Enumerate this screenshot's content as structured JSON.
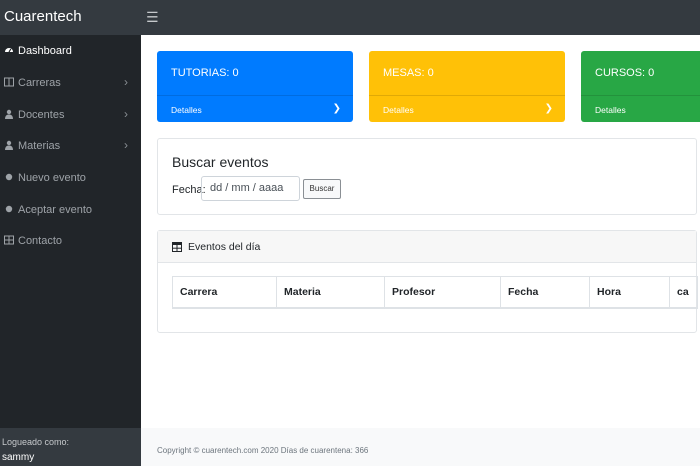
{
  "app": {
    "brand": "Cuarentech"
  },
  "sidebar": {
    "items": [
      {
        "label": "Dashboard",
        "icon": "dashboard-icon",
        "active": true
      },
      {
        "label": "Carreras",
        "icon": "columns-icon",
        "expandable": true
      },
      {
        "label": "Docentes",
        "icon": "user-icon",
        "expandable": true
      },
      {
        "label": "Materias",
        "icon": "user-icon",
        "expandable": true
      },
      {
        "label": "Nuevo evento",
        "icon": "dot-icon"
      },
      {
        "label": "Aceptar evento",
        "icon": "dot-icon"
      },
      {
        "label": "Contacto",
        "icon": "columns-icon"
      }
    ],
    "footer": {
      "logged_label": "Logueado como:",
      "username": "sammy"
    }
  },
  "cards": [
    {
      "title": "TUTORIAS: 0",
      "details": "Detalles",
      "color": "#007bff"
    },
    {
      "title": "MESAS: 0",
      "details": "Detalles",
      "color": "#ffc107"
    },
    {
      "title": "CURSOS: 0",
      "details": "Detalles",
      "color": "#28a745"
    }
  ],
  "search": {
    "title": "Buscar eventos",
    "fecha_label": "Fecha:",
    "date_placeholder": "dd / mm / aaaa",
    "button_label": "Buscar"
  },
  "events": {
    "title": "Eventos del día",
    "columns": [
      "Carrera",
      "Materia",
      "Profesor",
      "Fecha",
      "Hora",
      "ca"
    ]
  },
  "footer": {
    "text": "Copyright © cuarentech.com 2020  Días de cuarentena: 366"
  }
}
